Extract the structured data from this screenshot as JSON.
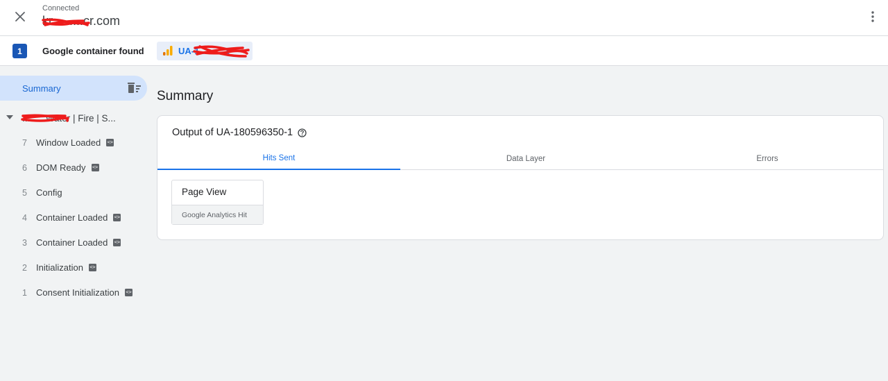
{
  "header": {
    "status": "Connected",
    "domain": "kr.........cr.com"
  },
  "container_bar": {
    "count": "1",
    "label": "Google container found",
    "chip_label": "UA-1..........1"
  },
  "sidebar": {
    "summary_label": "Summary",
    "page_title": "........ Water | Fire | S...",
    "events": [
      {
        "num": "7",
        "name": "Window Loaded",
        "has_code": true
      },
      {
        "num": "6",
        "name": "DOM Ready",
        "has_code": true
      },
      {
        "num": "5",
        "name": "Config",
        "has_code": false
      },
      {
        "num": "4",
        "name": "Container Loaded",
        "has_code": true
      },
      {
        "num": "3",
        "name": "Container Loaded",
        "has_code": true
      },
      {
        "num": "2",
        "name": "Initialization",
        "has_code": true
      },
      {
        "num": "1",
        "name": "Consent Initialization",
        "has_code": true
      }
    ]
  },
  "main": {
    "title": "Summary",
    "card_heading": "Output of UA-180596350-1",
    "tabs": [
      "Hits Sent",
      "Data Layer",
      "Errors"
    ],
    "active_tab": "Hits Sent",
    "hit": {
      "title": "Page View",
      "subtitle": "Google Analytics Hit"
    }
  },
  "colors": {
    "accent": "#1a73e8",
    "badge": "#1a57b5",
    "selected_bg": "#d2e3fc",
    "redaction": "#ee1c1c"
  }
}
